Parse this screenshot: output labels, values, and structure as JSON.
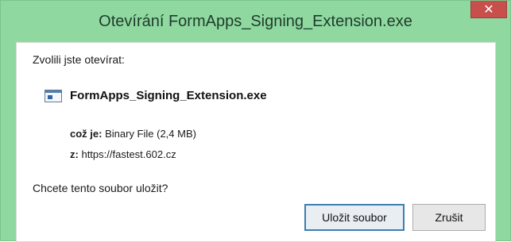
{
  "dialog": {
    "title": "Otevírání FormApps_Signing_Extension.exe",
    "close_icon": "close-icon"
  },
  "content": {
    "intro": "Zvolili jste otevírat:",
    "file_icon": "executable-file-icon",
    "file_name": "FormApps_Signing_Extension.exe",
    "type_label": "což je:",
    "type_value": "Binary File (2,4 MB)",
    "from_label": "z:",
    "from_value": "https://fastest.602.cz",
    "question": "Chcete tento soubor uložit?"
  },
  "buttons": {
    "save_label": "Uložit soubor",
    "cancel_label": "Zrušit"
  },
  "colors": {
    "titlebar": "#8fd9a1",
    "close": "#c7504c",
    "focus_border": "#3c7fb1"
  }
}
